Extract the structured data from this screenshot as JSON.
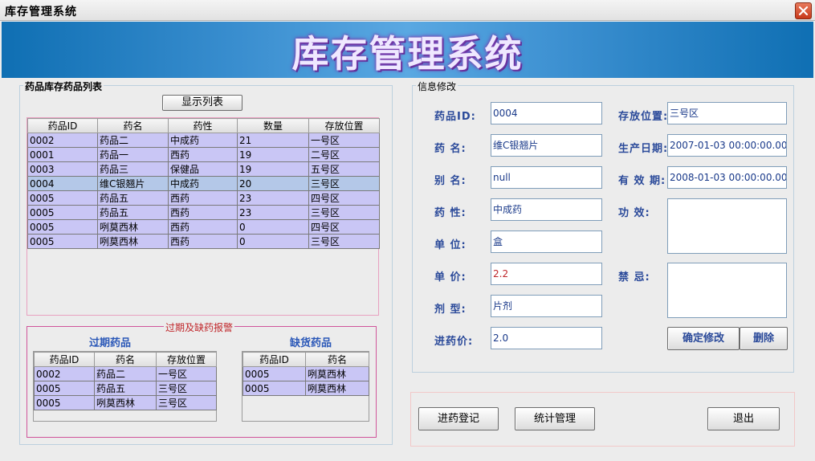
{
  "window": {
    "title": "库存管理系统"
  },
  "banner": {
    "title": "库存管理系统"
  },
  "drug_list": {
    "group_title": "药品库存药品列表",
    "show_button": "显示列表",
    "columns": [
      "药品ID",
      "药名",
      "药性",
      "数量",
      "存放位置"
    ],
    "rows": [
      [
        "0002",
        "药品二",
        "中成药",
        "21",
        "一号区"
      ],
      [
        "0001",
        "药品一",
        "西药",
        "19",
        "二号区"
      ],
      [
        "0003",
        "药品三",
        "保健品",
        "19",
        "五号区"
      ],
      [
        "0004",
        "维C银翘片",
        "中成药",
        "20",
        "三号区"
      ],
      [
        "0005",
        "药品五",
        "西药",
        "23",
        "四号区"
      ],
      [
        "0005",
        "药品五",
        "西药",
        "23",
        "三号区"
      ],
      [
        "0005",
        "咧莫西林",
        "西药",
        "0",
        "四号区"
      ],
      [
        "0005",
        "咧莫西林",
        "西药",
        "0",
        "三号区"
      ]
    ]
  },
  "alarm": {
    "group_title": "过期及缺药报警",
    "expired_title": "过期药品",
    "expired_columns": [
      "药品ID",
      "药名",
      "存放位置"
    ],
    "expired_rows": [
      [
        "0002",
        "药品二",
        "一号区"
      ],
      [
        "0005",
        "药品五",
        "三号区"
      ],
      [
        "0005",
        "咧莫西林",
        "三号区"
      ]
    ],
    "shortage_title": "缺货药品",
    "shortage_columns": [
      "药品ID",
      "药名"
    ],
    "shortage_rows": [
      [
        "0005",
        "咧莫西林"
      ],
      [
        "0005",
        "咧莫西林"
      ]
    ]
  },
  "info": {
    "group_title": "信息修改",
    "id_label": "药品ID:",
    "id_value": "0004",
    "name_label": "药 名:",
    "name_value": "维C银翘片",
    "alias_label": "别 名:",
    "alias_value": "null",
    "nature_label": "药 性:",
    "nature_value": "中成药",
    "unit_label": "单 位:",
    "unit_value": "盒",
    "price_label": "单 价:",
    "price_value": "2.2",
    "form_label": "剂 型:",
    "form_value": "片剂",
    "cost_label": "进药价:",
    "cost_value": "2.0",
    "location_label": "存放位置:",
    "location_value": "三号区",
    "prod_date_label": "生产日期:",
    "prod_date_value": "2007-01-03 00:00:00.000",
    "expiry_label": "有 效 期:",
    "expiry_value": "2008-01-03 00:00:00.000",
    "effect_label": "功 效:",
    "taboo_label": "禁 忌:",
    "confirm_button": "确定修改",
    "delete_button": "删除"
  },
  "bottom": {
    "register_button": "进药登记",
    "stats_button": "统计管理",
    "exit_button": "退出"
  },
  "colors": {
    "accent": "#2b4a9a",
    "row": "#c9c6f5",
    "selected_row": "#b4c8e8",
    "alarm_border": "#d0559a"
  }
}
